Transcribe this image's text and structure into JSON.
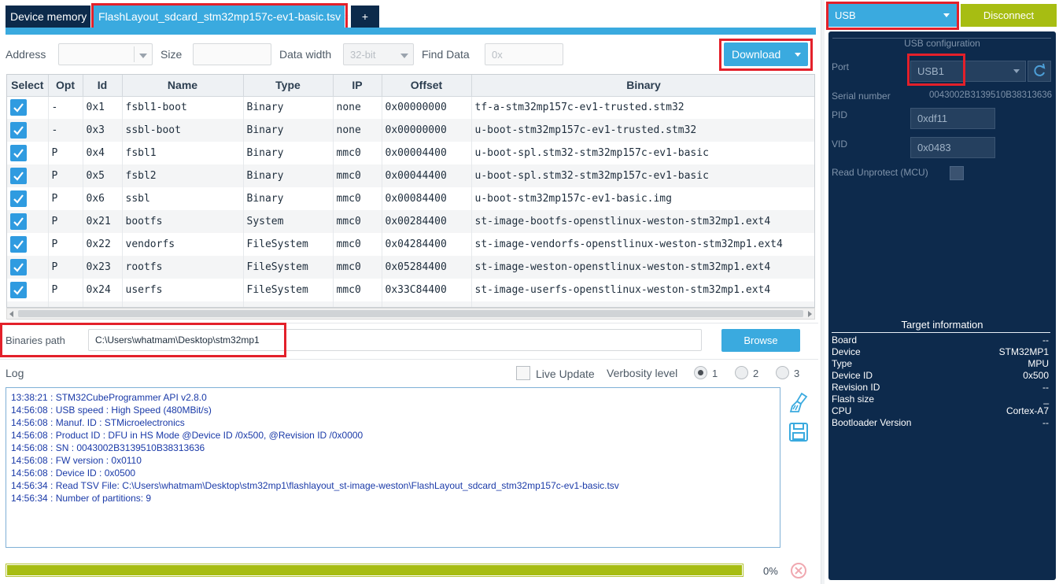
{
  "tabs": {
    "device_memory": "Device memory",
    "file": "FlashLayout_sdcard_stm32mp157c-ev1-basic.tsv",
    "close": "×",
    "add": "+"
  },
  "toolbar": {
    "address_label": "Address",
    "size_label": "Size",
    "data_width_label": "Data width",
    "data_width_value": "32-bit",
    "find_data_label": "Find Data",
    "find_data_placeholder": "0x",
    "download_label": "Download"
  },
  "table": {
    "headers": [
      "Select",
      "Opt",
      "Id",
      "Name",
      "Type",
      "IP",
      "Offset",
      "Binary"
    ],
    "rows": [
      {
        "opt": "-",
        "id": "0x1",
        "name": "fsbl1-boot",
        "type": "Binary",
        "ip": "none",
        "offset": "0x00000000",
        "binary": "tf-a-stm32mp157c-ev1-trusted.stm32"
      },
      {
        "opt": "-",
        "id": "0x3",
        "name": "ssbl-boot",
        "type": "Binary",
        "ip": "none",
        "offset": "0x00000000",
        "binary": "u-boot-stm32mp157c-ev1-trusted.stm32"
      },
      {
        "opt": "P",
        "id": "0x4",
        "name": "fsbl1",
        "type": "Binary",
        "ip": "mmc0",
        "offset": "0x00004400",
        "binary": "u-boot-spl.stm32-stm32mp157c-ev1-basic"
      },
      {
        "opt": "P",
        "id": "0x5",
        "name": "fsbl2",
        "type": "Binary",
        "ip": "mmc0",
        "offset": "0x00044400",
        "binary": "u-boot-spl.stm32-stm32mp157c-ev1-basic"
      },
      {
        "opt": "P",
        "id": "0x6",
        "name": "ssbl",
        "type": "Binary",
        "ip": "mmc0",
        "offset": "0x00084400",
        "binary": "u-boot-stm32mp157c-ev1-basic.img"
      },
      {
        "opt": "P",
        "id": "0x21",
        "name": "bootfs",
        "type": "System",
        "ip": "mmc0",
        "offset": "0x00284400",
        "binary": "st-image-bootfs-openstlinux-weston-stm32mp1.ext4"
      },
      {
        "opt": "P",
        "id": "0x22",
        "name": "vendorfs",
        "type": "FileSystem",
        "ip": "mmc0",
        "offset": "0x04284400",
        "binary": "st-image-vendorfs-openstlinux-weston-stm32mp1.ext4"
      },
      {
        "opt": "P",
        "id": "0x23",
        "name": "rootfs",
        "type": "FileSystem",
        "ip": "mmc0",
        "offset": "0x05284400",
        "binary": "st-image-weston-openstlinux-weston-stm32mp1.ext4"
      },
      {
        "opt": "P",
        "id": "0x24",
        "name": "userfs",
        "type": "FileSystem",
        "ip": "mmc0",
        "offset": "0x33C84400",
        "binary": "st-image-userfs-openstlinux-weston-stm32mp1.ext4"
      }
    ]
  },
  "binaries": {
    "label": "Binaries path",
    "value": "C:\\Users\\whatmam\\Desktop\\stm32mp1",
    "browse": "Browse"
  },
  "log": {
    "title": "Log",
    "live_update": "Live Update",
    "verbosity_label": "Verbosity level",
    "levels": [
      "1",
      "2",
      "3"
    ],
    "lines": [
      "13:38:21 : STM32CubeProgrammer API v2.8.0",
      "14:56:08 : USB speed   : High Speed (480MBit/s)",
      "14:56:08 : Manuf. ID   : STMicroelectronics",
      "14:56:08 : Product ID  : DFU in HS Mode @Device ID /0x500, @Revision ID /0x0000",
      "14:56:08 : SN          : 0043002B3139510B38313636",
      "14:56:08 : FW version  : 0x0110",
      "14:56:08 : Device ID   : 0x0500",
      "14:56:34 : Read TSV File: C:\\Users\\whatmam\\Desktop\\stm32mp1\\flashlayout_st-image-weston\\FlashLayout_sdcard_stm32mp157c-ev1-basic.tsv",
      "14:56:34 : Number of partitions: 9"
    ]
  },
  "progress": {
    "value": 1.0,
    "text": "0%"
  },
  "right": {
    "interface": "USB",
    "disconnect": "Disconnect",
    "usb_config_title": "USB configuration",
    "port_label": "Port",
    "port_value": "USB1",
    "serial_label": "Serial number",
    "serial_value": "0043002B3139510B38313636",
    "pid_label": "PID",
    "pid_value": "0xdf11",
    "vid_label": "VID",
    "vid_value": "0x0483",
    "read_unprotect_label": "Read Unprotect (MCU)",
    "target_title": "Target information",
    "target": [
      {
        "k": "Board",
        "v": "--"
      },
      {
        "k": "Device",
        "v": "STM32MP1"
      },
      {
        "k": "Type",
        "v": "MPU"
      },
      {
        "k": "Device ID",
        "v": "0x500"
      },
      {
        "k": "Revision ID",
        "v": "--"
      },
      {
        "k": "Flash size",
        "v": "_"
      },
      {
        "k": "CPU",
        "v": "Cortex-A7"
      },
      {
        "k": "Bootloader Version",
        "v": "--"
      }
    ]
  },
  "colors": {
    "accent": "#3aaadf",
    "navy": "#0d2a4c",
    "disconnect": "#a7bd12",
    "highlight": "#e3202a"
  }
}
